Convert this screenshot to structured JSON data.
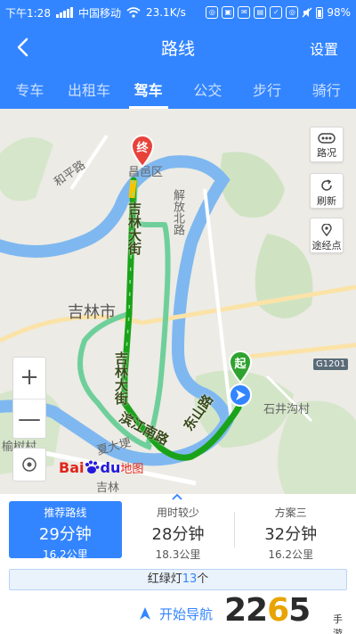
{
  "status_bar": {
    "time": "下午1:28",
    "carrier": "中国移动",
    "speed": "23.1K/s",
    "battery": "98%"
  },
  "header": {
    "title": "路线",
    "settings_label": "设置"
  },
  "tabs": [
    {
      "label": "专车",
      "active": false
    },
    {
      "label": "出租车",
      "active": false
    },
    {
      "label": "驾车",
      "active": true
    },
    {
      "label": "公交",
      "active": false
    },
    {
      "label": "步行",
      "active": false
    },
    {
      "label": "骑行",
      "active": false
    }
  ],
  "map": {
    "labels": {
      "city": "吉林市",
      "district": "昌邑区",
      "heping_road": "和平路",
      "jiefang_north_road": "解放北路",
      "jilin_avenue_top": "吉林大街",
      "jilin_avenue_bottom": "吉林大街",
      "binjiang_south_road": "滨江南路",
      "dongshan_road": "东山路",
      "shijinggou": "石井沟村",
      "yushu": "榆树村",
      "xiaobaozi": "夏大埂",
      "jilin_bottom": "吉林",
      "highway": "G1201"
    },
    "end_marker": "终",
    "start_marker": "起",
    "controls": {
      "traffic_label": "路况",
      "refresh_label": "刷新",
      "waypoint_label": "途经点",
      "zoom_in": "+",
      "zoom_out": "—"
    },
    "logo": {
      "bai": "Bai",
      "du": "du",
      "map": "地图"
    },
    "route_color": "#1aa31a",
    "alt_route_color": "#6fcf9a"
  },
  "plans": [
    {
      "label": "推荐路线",
      "time": "29分钟",
      "distance": "16.2公里",
      "active": true
    },
    {
      "label": "用时较少",
      "time": "28分钟",
      "distance": "18.3公里",
      "active": false
    },
    {
      "label": "方案三",
      "time": "32分钟",
      "distance": "16.2公里",
      "active": false
    }
  ],
  "traffic_lights": {
    "prefix": "红绿灯",
    "count": "13",
    "suffix": "个"
  },
  "navigation": {
    "label": "开始导航"
  },
  "watermark": {
    "text_a": "22",
    "text_b": "6",
    "text_c": "5",
    "site": "手游网"
  }
}
